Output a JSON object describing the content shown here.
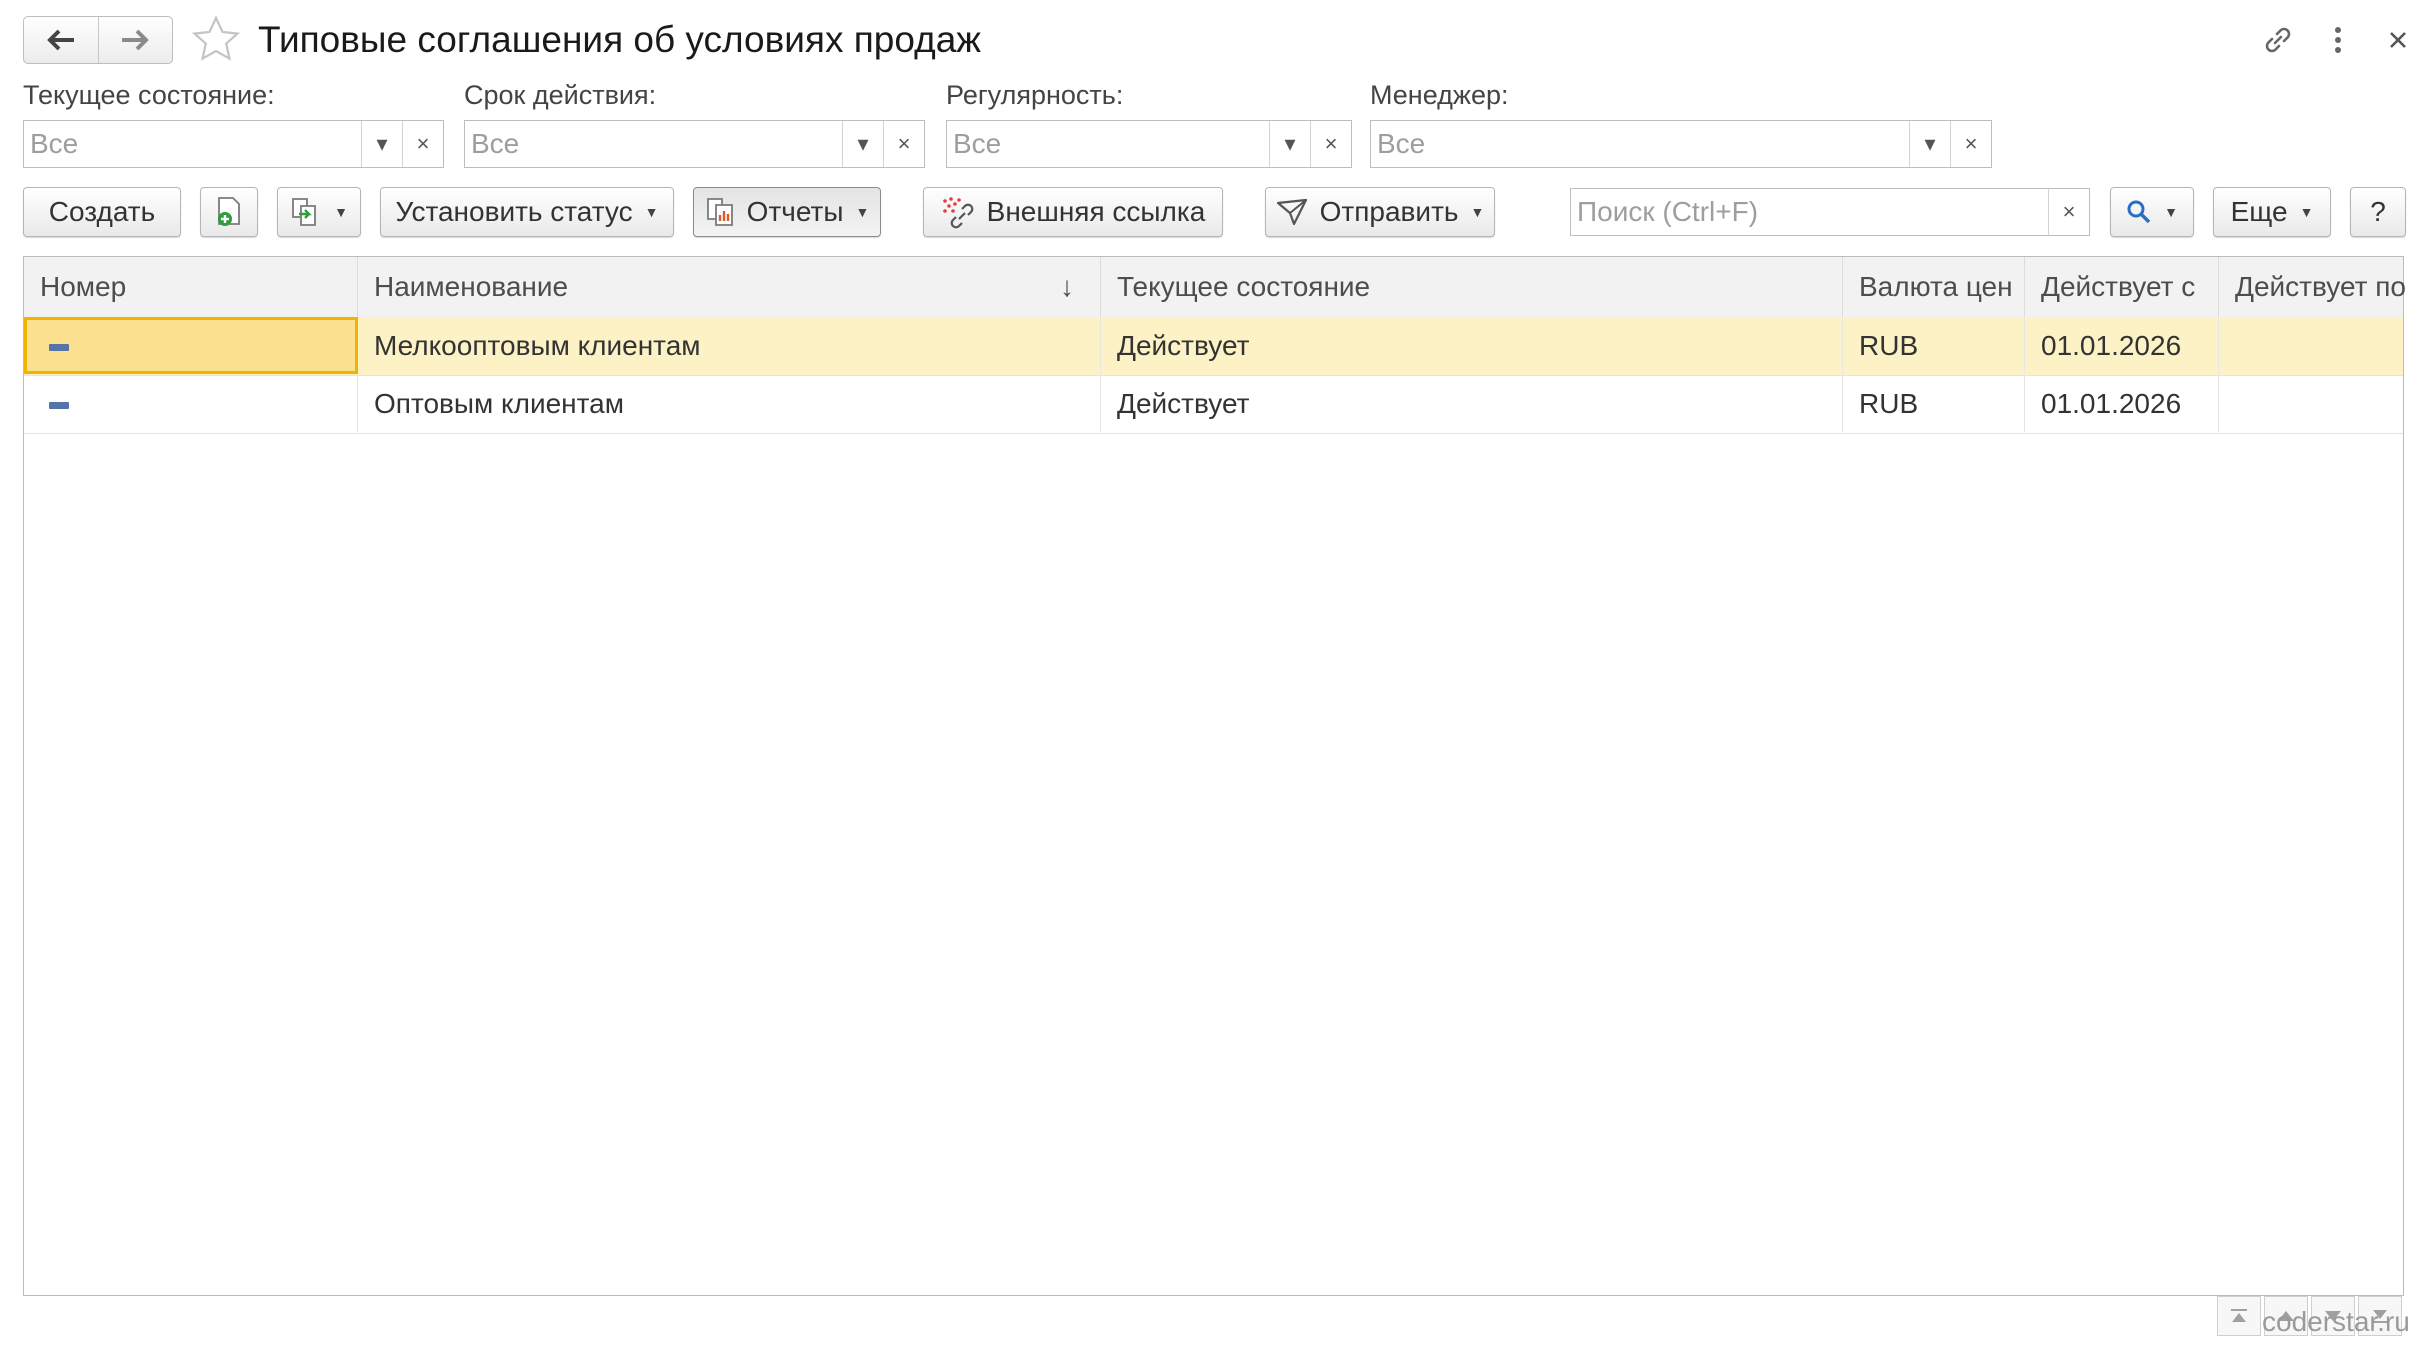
{
  "window": {
    "title": "Типовые соглашения об условиях продаж"
  },
  "filters": [
    {
      "label": "Текущее состояние:",
      "value": "Все"
    },
    {
      "label": "Срок действия:",
      "value": "Все"
    },
    {
      "label": "Регулярность:",
      "value": "Все"
    },
    {
      "label": "Менеджер:",
      "value": "Все"
    }
  ],
  "toolbar": {
    "create_label": "Создать",
    "set_status_label": "Установить статус",
    "reports_label": "Отчеты",
    "external_link_label": "Внешняя ссылка",
    "send_label": "Отправить",
    "more_label": "Еще",
    "help_label": "?"
  },
  "search": {
    "placeholder": "Поиск (Ctrl+F)"
  },
  "table": {
    "columns": [
      "Номер",
      "Наименование",
      "Текущее состояние",
      "Валюта цен",
      "Действует с",
      "Действует по"
    ],
    "sort_indicator": "↓",
    "rows": [
      {
        "number": "",
        "name": "Мелкооптовым клиентам",
        "state": "Действует",
        "currency": "RUB",
        "from": "01.01.2026",
        "to": "",
        "selected": true
      },
      {
        "number": "",
        "name": "Оптовым клиентам",
        "state": "Действует",
        "currency": "RUB",
        "from": "01.01.2026",
        "to": "",
        "selected": false
      }
    ]
  },
  "watermark": "coderstar.ru"
}
